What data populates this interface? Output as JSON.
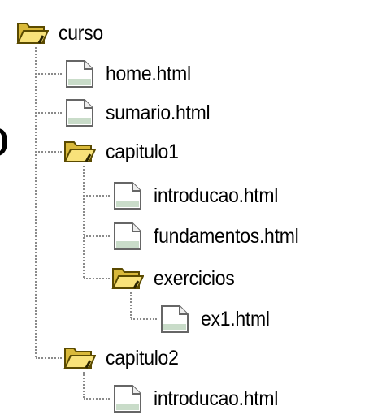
{
  "colors": {
    "folder_fill": "#f8e27a",
    "folder_shade": "#d9b93a",
    "folder_outline": "#5a4a00",
    "file_fill": "#ffffff",
    "file_shade": "#c9dcc9",
    "guide_line": "#8a8a8a"
  },
  "stray_text": "o",
  "tree": {
    "root": {
      "label": "curso",
      "icon": "folder-open-icon"
    },
    "items": [
      {
        "label": "home.html",
        "icon": "file-icon"
      },
      {
        "label": "sumario.html",
        "icon": "file-icon"
      },
      {
        "label": "capitulo1",
        "icon": "folder-open-icon"
      },
      {
        "label": "introducao.html",
        "icon": "file-icon"
      },
      {
        "label": "fundamentos.html",
        "icon": "file-icon"
      },
      {
        "label": "exercicios",
        "icon": "folder-open-icon"
      },
      {
        "label": "ex1.html",
        "icon": "file-icon"
      },
      {
        "label": "capitulo2",
        "icon": "folder-open-icon"
      },
      {
        "label": "introducao.html",
        "icon": "file-icon"
      }
    ]
  }
}
